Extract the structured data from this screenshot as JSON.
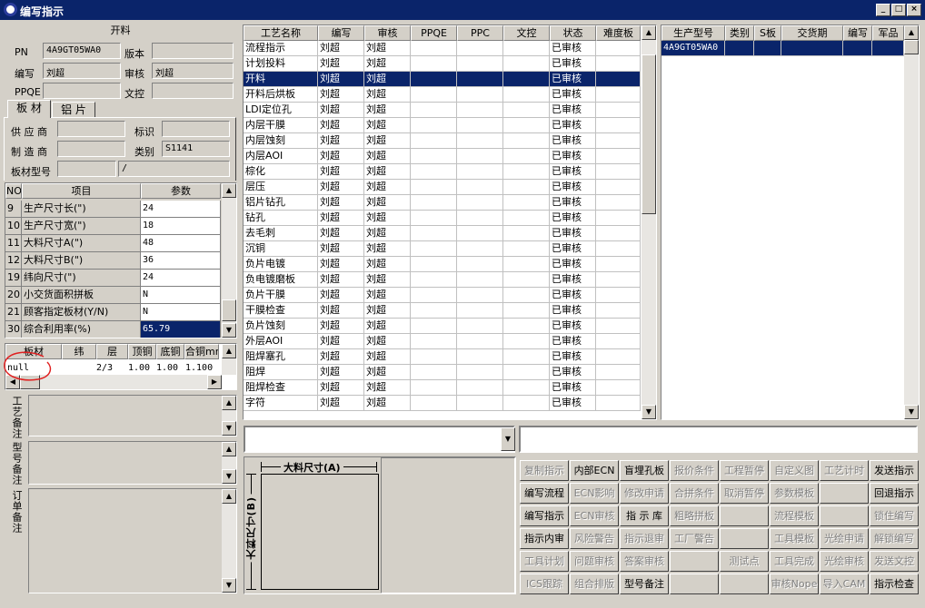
{
  "window": {
    "title": "编写指示",
    "min": "_",
    "max": "□",
    "close": "×"
  },
  "left": {
    "section_title": "开料",
    "pn_label": "PN",
    "pn_value": "4A9GT05WA0",
    "version_label": "版本",
    "version_value": "",
    "writer_label": "编写",
    "writer_value": "刘超",
    "reviewer_label": "审核",
    "reviewer_value": "刘超",
    "ppqe_label": "PPQE",
    "ppqe_value": "",
    "doccontrol_label": "文控",
    "doccontrol_value": "",
    "tabs": [
      "板 材",
      "铝 片"
    ],
    "supplier_label": "供 应 商",
    "supplier_value": "",
    "mark_label": "标识",
    "mark_value": "",
    "maker_label": "制 造 商",
    "maker_value": "",
    "category_label": "类别",
    "category_value": "S1141",
    "model_label": "板材型号",
    "model_value": "",
    "model_value2": "/",
    "param_headers": [
      "NO",
      "项目",
      "参数"
    ],
    "params": [
      [
        "9",
        "生产尺寸长(\")",
        "24"
      ],
      [
        "10",
        "生产尺寸宽(\")",
        "18"
      ],
      [
        "11",
        "大料尺寸A(\")",
        "48"
      ],
      [
        "12",
        "大料尺寸B(\")",
        "36"
      ],
      [
        "19",
        "纬向尺寸(\")",
        "24"
      ],
      [
        "20",
        "小交货面积拼板",
        "N"
      ],
      [
        "21",
        "顾客指定板材(Y/N)",
        "N"
      ],
      [
        "30",
        "综合利用率(%)",
        "65.79"
      ]
    ],
    "board_headers": [
      "板材",
      "纬",
      "层",
      "顶铜",
      "底铜",
      "合铜mm"
    ],
    "board_row": [
      "null",
      "",
      "2/3",
      "1.00",
      "1.00",
      "1.100"
    ],
    "notes": [
      "工艺备注",
      "型号备注",
      "订单备注"
    ]
  },
  "process": {
    "headers": [
      "工艺名称",
      "编写",
      "审核",
      "PPQE",
      "PPC",
      "文控",
      "状态",
      "难度板"
    ],
    "rows": [
      [
        "流程指示",
        "刘超",
        "刘超",
        "",
        "",
        "",
        "已审核",
        ""
      ],
      [
        "计划投料",
        "刘超",
        "刘超",
        "",
        "",
        "",
        "已审核",
        ""
      ],
      [
        "开料",
        "刘超",
        "刘超",
        "",
        "",
        "",
        "已审核",
        ""
      ],
      [
        "开料后烘板",
        "刘超",
        "刘超",
        "",
        "",
        "",
        "已审核",
        ""
      ],
      [
        "LDI定位孔",
        "刘超",
        "刘超",
        "",
        "",
        "",
        "已审核",
        ""
      ],
      [
        "内层干膜",
        "刘超",
        "刘超",
        "",
        "",
        "",
        "已审核",
        ""
      ],
      [
        "内层蚀刻",
        "刘超",
        "刘超",
        "",
        "",
        "",
        "已审核",
        ""
      ],
      [
        "内层AOI",
        "刘超",
        "刘超",
        "",
        "",
        "",
        "已审核",
        ""
      ],
      [
        "棕化",
        "刘超",
        "刘超",
        "",
        "",
        "",
        "已审核",
        ""
      ],
      [
        "层压",
        "刘超",
        "刘超",
        "",
        "",
        "",
        "已审核",
        ""
      ],
      [
        "铝片钻孔",
        "刘超",
        "刘超",
        "",
        "",
        "",
        "已审核",
        ""
      ],
      [
        "钻孔",
        "刘超",
        "刘超",
        "",
        "",
        "",
        "已审核",
        ""
      ],
      [
        "去毛刺",
        "刘超",
        "刘超",
        "",
        "",
        "",
        "已审核",
        ""
      ],
      [
        "沉铜",
        "刘超",
        "刘超",
        "",
        "",
        "",
        "已审核",
        ""
      ],
      [
        "负片电镀",
        "刘超",
        "刘超",
        "",
        "",
        "",
        "已审核",
        ""
      ],
      [
        "负电镀磨板",
        "刘超",
        "刘超",
        "",
        "",
        "",
        "已审核",
        ""
      ],
      [
        "负片干膜",
        "刘超",
        "刘超",
        "",
        "",
        "",
        "已审核",
        ""
      ],
      [
        "干膜检查",
        "刘超",
        "刘超",
        "",
        "",
        "",
        "已审核",
        ""
      ],
      [
        "负片蚀刻",
        "刘超",
        "刘超",
        "",
        "",
        "",
        "已审核",
        ""
      ],
      [
        "外层AOI",
        "刘超",
        "刘超",
        "",
        "",
        "",
        "已审核",
        ""
      ],
      [
        "阻焊塞孔",
        "刘超",
        "刘超",
        "",
        "",
        "",
        "已审核",
        ""
      ],
      [
        "阻焊",
        "刘超",
        "刘超",
        "",
        "",
        "",
        "已审核",
        ""
      ],
      [
        "阻焊检查",
        "刘超",
        "刘超",
        "",
        "",
        "",
        "已审核",
        ""
      ],
      [
        "字符",
        "刘超",
        "刘超",
        "",
        "",
        "",
        "已审核",
        ""
      ]
    ],
    "selected_index": 2
  },
  "orders": {
    "headers": [
      "生产型号",
      "类别",
      "S板",
      "交货期",
      "编写",
      "军品"
    ],
    "rows": [
      [
        "4A9GT05WA0",
        "",
        "",
        "",
        "",
        ""
      ]
    ]
  },
  "diagram": {
    "a_label": "大料尺寸(A)",
    "b_label": "大料尺寸(B)"
  },
  "buttons": [
    [
      "复制指示",
      "内部ECN",
      "盲埋孔板",
      "报价条件",
      "工程暂停",
      "自定义图",
      "工艺计时",
      "发送指示"
    ],
    [
      "编写流程",
      "ECN影响",
      "修改申请",
      "合拼条件",
      "取消暂停",
      "参数模板",
      "",
      "回退指示"
    ],
    [
      "编写指示",
      "ECN审核",
      "指 示 库",
      "粗略拼板",
      "",
      "流程模板",
      "",
      "锁住编写"
    ],
    [
      "指示内审",
      "风险警告",
      "指示退审",
      "工厂警告",
      "",
      "工具模板",
      "光绘申请",
      "解锁编写"
    ],
    [
      "工具计划",
      "问题审核",
      "答案审核",
      "",
      "测试点",
      "工具完成",
      "光绘审核",
      "发送文控"
    ],
    [
      "ICS跟踪",
      "组合排版",
      "型号备注",
      "",
      "",
      "审核Nope",
      "导入CAM",
      "指示检查"
    ]
  ],
  "button_enabled": [
    [
      0,
      1,
      1,
      0,
      0,
      0,
      0,
      1
    ],
    [
      1,
      0,
      0,
      0,
      0,
      0,
      0,
      1
    ],
    [
      1,
      0,
      1,
      0,
      0,
      0,
      0,
      0
    ],
    [
      1,
      0,
      0,
      0,
      0,
      0,
      0,
      0
    ],
    [
      0,
      0,
      0,
      0,
      0,
      0,
      0,
      0
    ],
    [
      0,
      0,
      1,
      0,
      0,
      0,
      0,
      1
    ]
  ]
}
